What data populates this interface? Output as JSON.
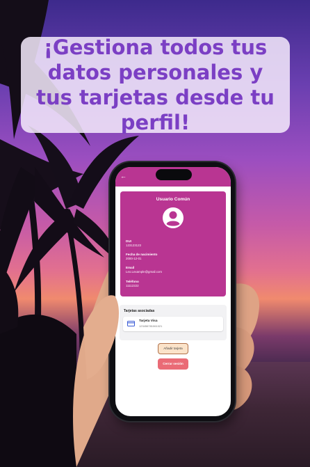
{
  "headline": "¡Gestiona todos tus datos personales y tus tarjetas desde tu perfil!",
  "app": {
    "back_icon": "arrow-left-icon",
    "profile": {
      "title": "Usuario Común",
      "avatar_icon": "person-circle-icon",
      "fields": [
        {
          "label": "DUI",
          "value": "123123123"
        },
        {
          "label": "Fecha de nacimiento",
          "value": "2000-12-01"
        },
        {
          "label": "Email",
          "value": "Leo.Lexample@gmail.com"
        },
        {
          "label": "Teléfono",
          "value": "11112222"
        }
      ]
    },
    "cards_section": {
      "title": "Tarjetas asociadas",
      "cards": [
        {
          "icon": "credit-card-icon",
          "name": "Tarjeta Visa",
          "number": "123456781061021"
        }
      ]
    },
    "buttons": {
      "add_card": "Añadir tarjeta",
      "logout": "Cerrar sesión"
    }
  },
  "colors": {
    "primary": "#b93592",
    "headline_text": "#7b3fc4",
    "logout_button": "#ea6b76",
    "add_button": "#fbe3c9"
  }
}
